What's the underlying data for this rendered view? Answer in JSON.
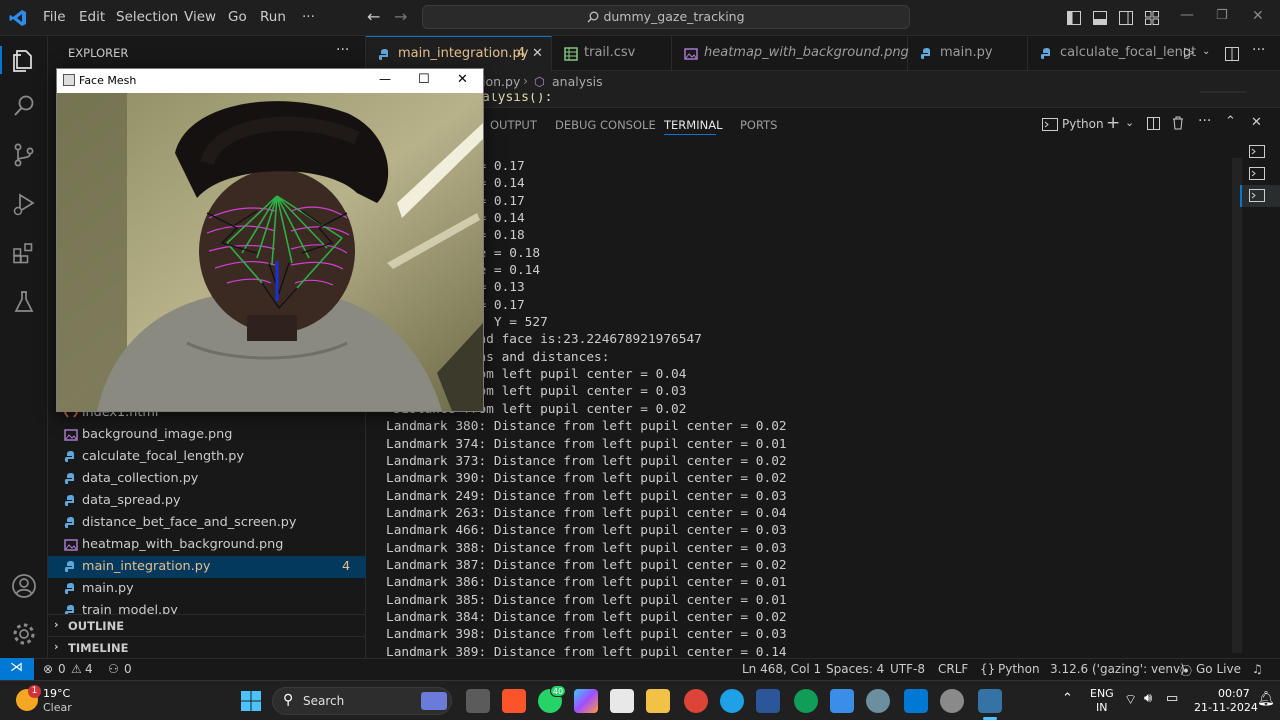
{
  "menu": [
    "File",
    "Edit",
    "Selection",
    "View",
    "Go",
    "Run",
    "···"
  ],
  "command_center": "dummy_gaze_tracking",
  "sidebar": {
    "title": "EXPLORER",
    "more": "···",
    "files": [
      {
        "name": "index1.html",
        "icon": "html-file-icon",
        "badge": ""
      },
      {
        "name": "background_image.png",
        "icon": "image-file-icon",
        "badge": ""
      },
      {
        "name": "calculate_focal_length.py",
        "icon": "python-file-icon",
        "badge": ""
      },
      {
        "name": "data_collection.py",
        "icon": "python-file-icon",
        "badge": ""
      },
      {
        "name": "data_spread.py",
        "icon": "python-file-icon",
        "badge": ""
      },
      {
        "name": "distance_bet_face_and_screen.py",
        "icon": "python-file-icon",
        "badge": ""
      },
      {
        "name": "heatmap_with_background.png",
        "icon": "image-file-icon",
        "badge": ""
      },
      {
        "name": "main_integration.py",
        "icon": "python-file-icon",
        "badge": "4"
      },
      {
        "name": "main.py",
        "icon": "python-file-icon",
        "badge": ""
      },
      {
        "name": "train_model.py",
        "icon": "python-file-icon",
        "badge": ""
      }
    ],
    "outline": "OUTLINE",
    "timeline": "TIMELINE"
  },
  "tabs": [
    {
      "label": "main_integration.py",
      "badge": "4",
      "close": "✕"
    },
    {
      "label": "trail.csv"
    },
    {
      "label": "heatmap_with_background.png"
    },
    {
      "label": "main.py"
    },
    {
      "label": "calculate_focal_lengt"
    }
  ],
  "breadcrumb": {
    "file": "ion.py",
    "symbol": "analysis"
  },
  "editor_peek": "alysis():",
  "panel": {
    "tabs": [
      "OUTPUT",
      "DEBUG CONSOLE",
      "TERMINAL",
      "PORTS"
    ],
    "active_tab": "TERMINAL",
    "shell": "Python",
    "terminal_lines": [
      " Difference = 0.17",
      " Difference = 0.14",
      " Difference = 0.17",
      " Difference = 0.14",
      " Difference = 0.18",
      "aw Difference = 0.18",
      "aw Difference = 0.14",
      " Difference = 0.13",
      " Difference = 0.17",
      "on: X = 1455, Y = 527",
      "een screen and face is:23.224678921976547",
      "tive positions and distances:",
      " Distance from left pupil center = 0.04",
      " Distance from left pupil center = 0.03",
      " Distance from left pupil center = 0.02",
      "Landmark 380: Distance from left pupil center = 0.02",
      "Landmark 374: Distance from left pupil center = 0.01",
      "Landmark 373: Distance from left pupil center = 0.02",
      "Landmark 390: Distance from left pupil center = 0.02",
      "Landmark 249: Distance from left pupil center = 0.03",
      "Landmark 263: Distance from left pupil center = 0.04",
      "Landmark 466: Distance from left pupil center = 0.03",
      "Landmark 388: Distance from left pupil center = 0.03",
      "Landmark 387: Distance from left pupil center = 0.02",
      "Landmark 386: Distance from left pupil center = 0.01",
      "Landmark 385: Distance from left pupil center = 0.01",
      "Landmark 384: Distance from left pupil center = 0.02",
      "Landmark 398: Distance from left pupil center = 0.03",
      "Landmark 389: Distance from left pupil center = 0.14"
    ]
  },
  "statusbar": {
    "errors": "0",
    "warnings": "4",
    "ports": "0",
    "position": "Ln 468, Col 1",
    "spaces": "Spaces: 4",
    "encoding": "UTF-8",
    "eol": "CRLF",
    "braces": "{}",
    "language": "Python",
    "interpreter": "3.12.6 ('gazing': venv)",
    "golive": "Go Live"
  },
  "facemesh_window": {
    "title": "Face Mesh",
    "minimize": "—",
    "maximize": "☐",
    "close": "✕"
  },
  "taskbar": {
    "weather_temp": "19°C",
    "weather_desc": "Clear",
    "weather_badge": "1",
    "search": "Search",
    "whatsapp_badge": "40",
    "lang1": "ENG",
    "lang2": "IN",
    "time": "00:07",
    "date": "21-11-2024"
  },
  "colors": {
    "accent": "#0078d4",
    "tab_active_border": "#0078d4",
    "badge_warn": "#cca700"
  }
}
